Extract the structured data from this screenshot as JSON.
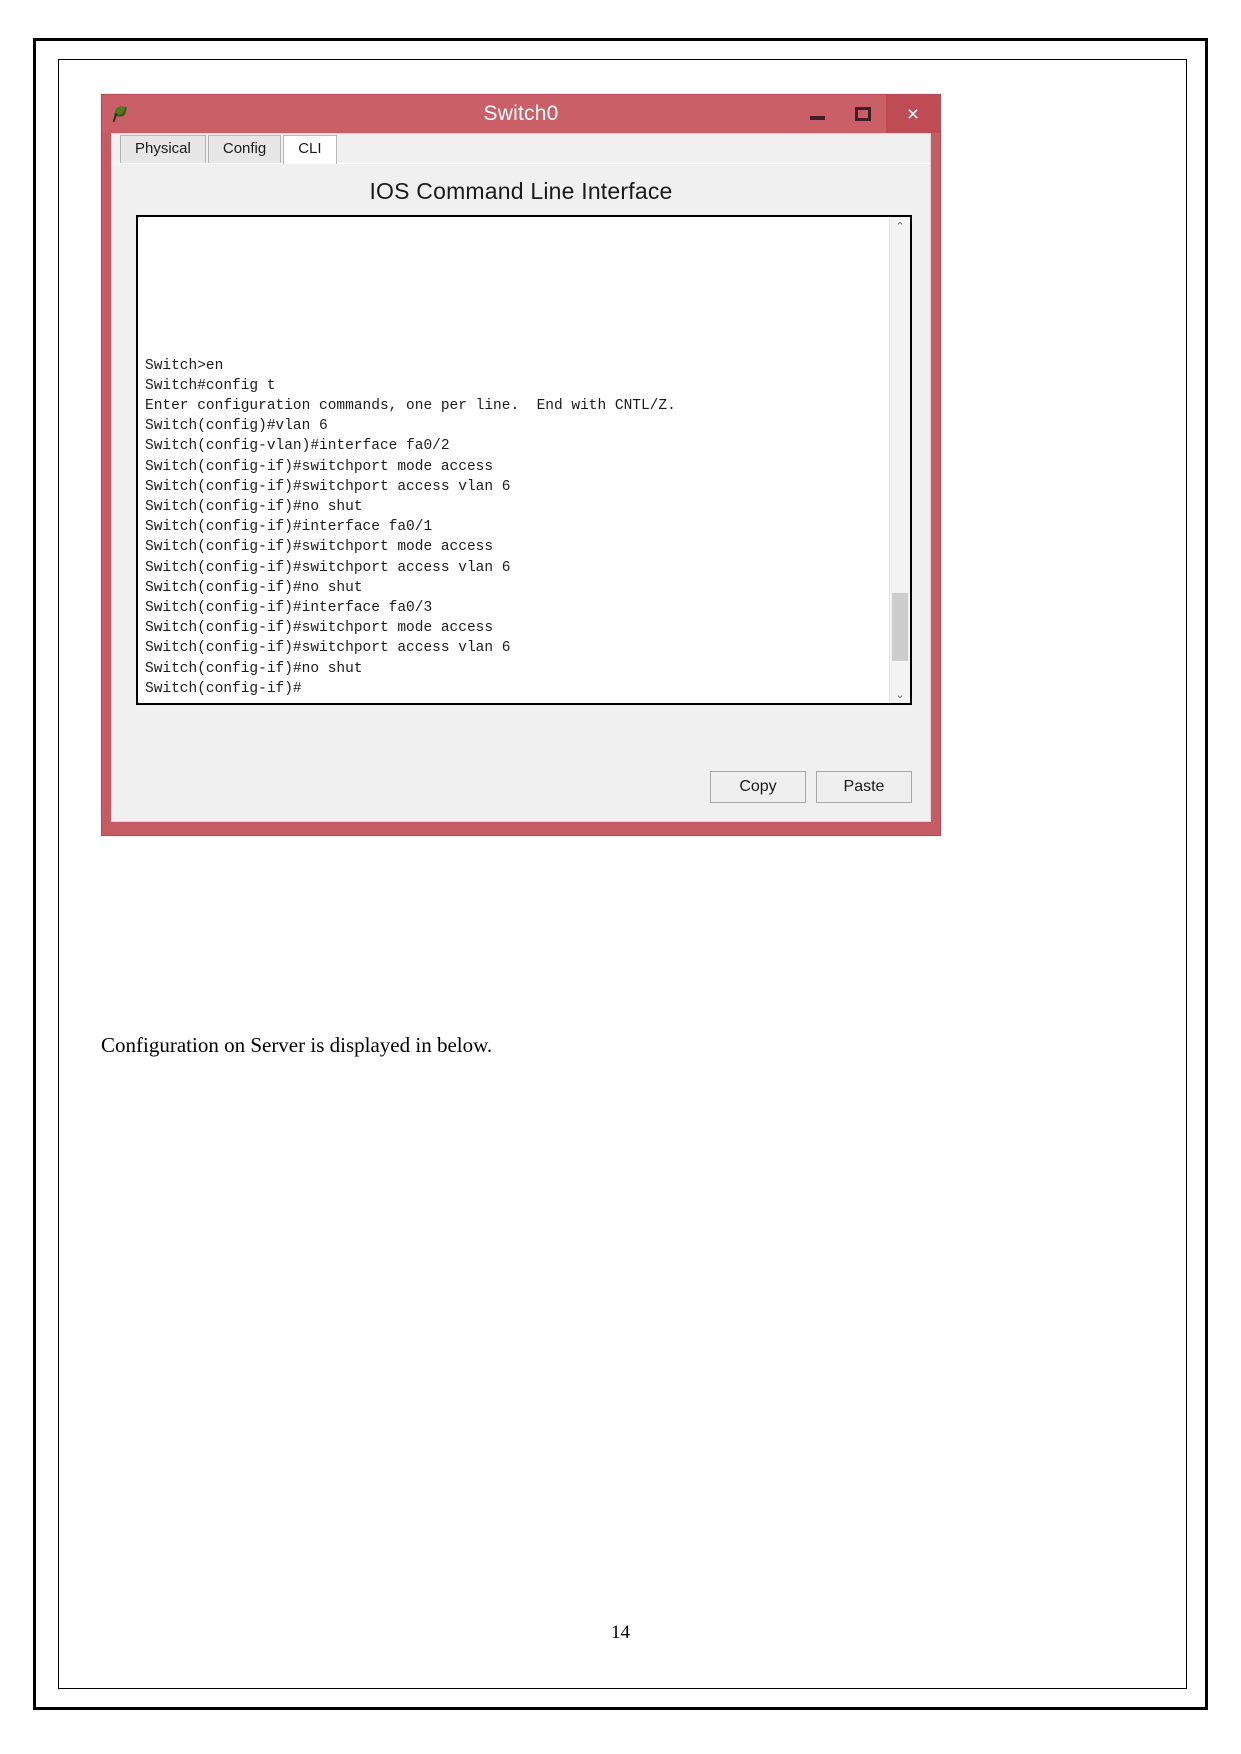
{
  "document": {
    "caption": "Configuration on Server is displayed in below.",
    "page_number": "14"
  },
  "window": {
    "title": "Switch0",
    "app_icon": "packet-tracer-icon",
    "controls": {
      "minimize": "–",
      "maximize": "❑",
      "close": "×"
    },
    "titlebar_color": "#cb5f68",
    "close_button_color": "#bf4b55"
  },
  "tabs": [
    {
      "label": "Physical",
      "active": false
    },
    {
      "label": "Config",
      "active": false
    },
    {
      "label": "CLI",
      "active": true
    }
  ],
  "cli": {
    "heading": "IOS Command Line Interface",
    "terminal_output": "Switch>en\nSwitch#config t\nEnter configuration commands, one per line.  End with CNTL/Z.\nSwitch(config)#vlan 6\nSwitch(config-vlan)#interface fa0/2\nSwitch(config-if)#switchport mode access\nSwitch(config-if)#switchport access vlan 6\nSwitch(config-if)#no shut\nSwitch(config-if)#interface fa0/1\nSwitch(config-if)#switchport mode access\nSwitch(config-if)#switchport access vlan 6\nSwitch(config-if)#no shut\nSwitch(config-if)#interface fa0/3\nSwitch(config-if)#switchport mode access\nSwitch(config-if)#switchport access vlan 6\nSwitch(config-if)#no shut\nSwitch(config-if)#",
    "terminal_lines": [
      "Switch>en",
      "Switch#config t",
      "Enter configuration commands, one per line.  End with CNTL/Z.",
      "Switch(config)#vlan 6",
      "Switch(config-vlan)#interface fa0/2",
      "Switch(config-if)#switchport mode access",
      "Switch(config-if)#switchport access vlan 6",
      "Switch(config-if)#no shut",
      "Switch(config-if)#interface fa0/1",
      "Switch(config-if)#switchport mode access",
      "Switch(config-if)#switchport access vlan 6",
      "Switch(config-if)#no shut",
      "Switch(config-if)#interface fa0/3",
      "Switch(config-if)#switchport mode access",
      "Switch(config-if)#switchport access vlan 6",
      "Switch(config-if)#no shut",
      "Switch(config-if)#"
    ],
    "scroll_up_arrow": "⌃",
    "scroll_down_arrow": "⌄",
    "buttons": {
      "copy": "Copy",
      "paste": "Paste"
    }
  }
}
